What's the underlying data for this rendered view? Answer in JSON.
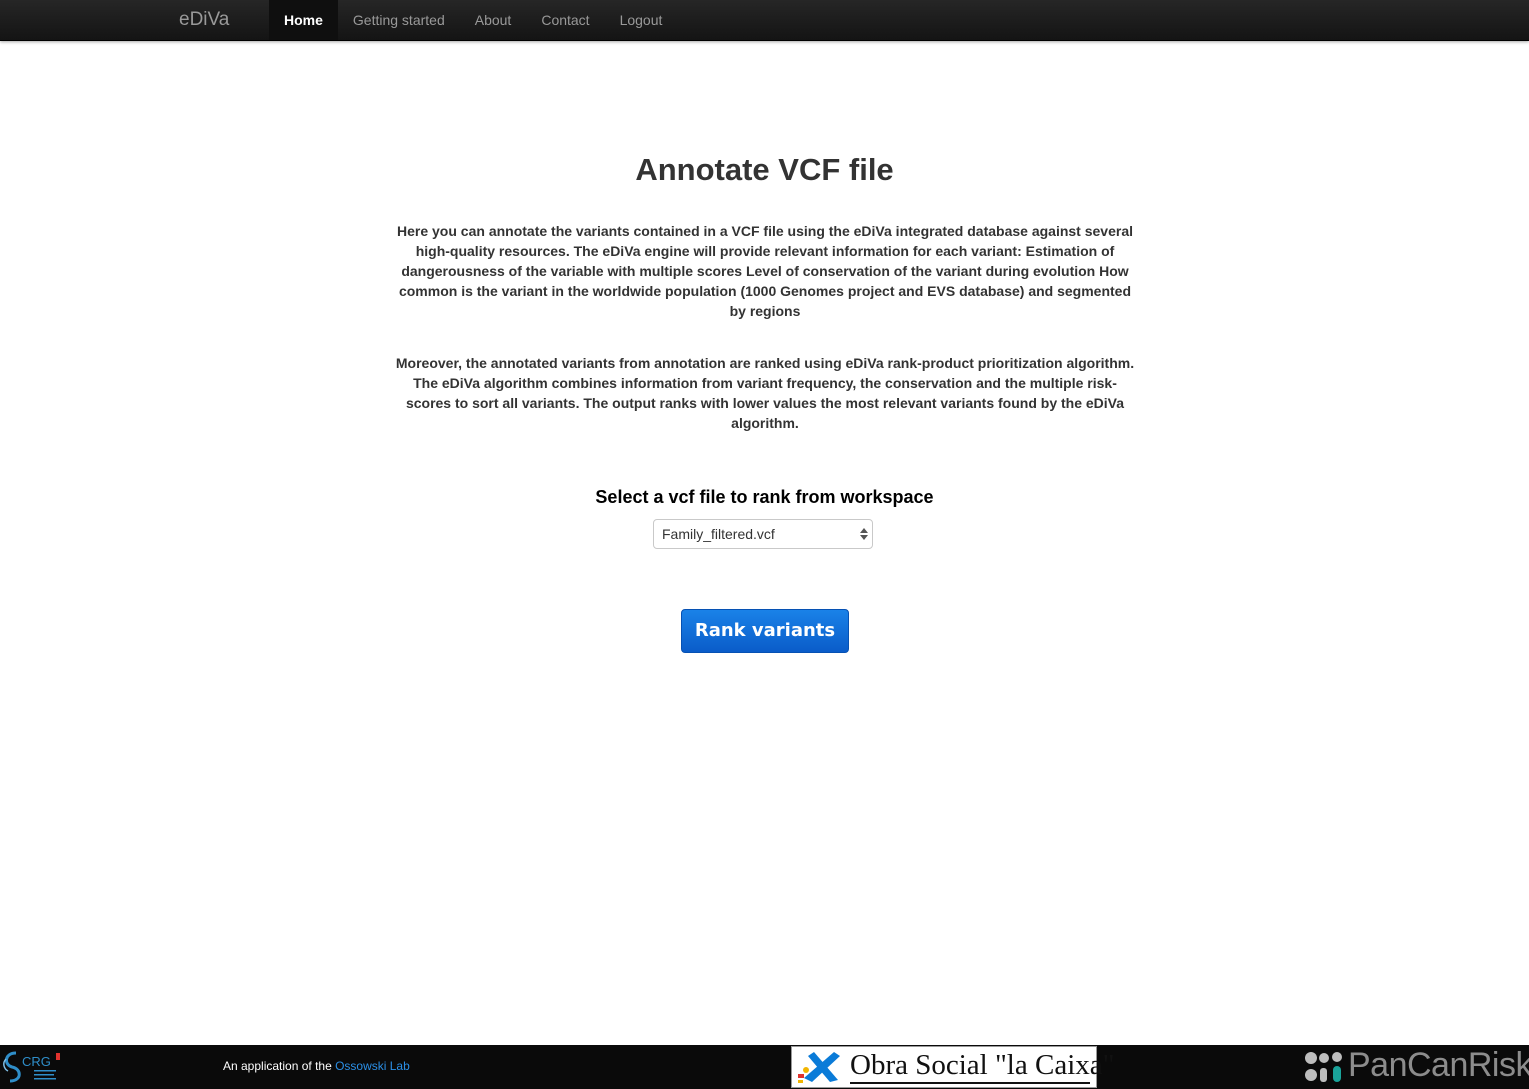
{
  "navbar": {
    "brand": "eDiVa",
    "items": [
      {
        "label": "Home",
        "active": true
      },
      {
        "label": "Getting started",
        "active": false
      },
      {
        "label": "About",
        "active": false
      },
      {
        "label": "Contact",
        "active": false
      },
      {
        "label": "Logout",
        "active": false
      }
    ]
  },
  "main": {
    "title": "Annotate VCF file",
    "paragraph_1": "Here you can annotate the variants contained in a VCF file using the eDiVa integrated database against several high-quality resources. The eDiVa engine will provide relevant information for each variant: Estimation of dangerousness of the variable with multiple scores Level of conservation of the variant during evolution How common is the variant in the worldwide population (1000 Genomes project and EVS database) and segmented by regions",
    "paragraph_2": "Moreover, the annotated variants from annotation are ranked using eDiVa rank-product prioritization algorithm. The eDiVa algorithm combines information from variant frequency, the conservation and the multiple risk-scores to sort all variants. The output ranks with lower values the most relevant variants found by the eDiVa algorithm.",
    "select_label": "Select a vcf file to rank from workspace",
    "select_value": "Family_filtered.vcf",
    "rank_button": "Rank variants"
  },
  "footer": {
    "crg_logo_text": "CRG",
    "app_text": "An application of the ",
    "lab_link": "Ossowski Lab",
    "caixa_logo_text": "Obra Social \"la Caixa\"",
    "pancan_logo_text": "PanCanRisk"
  },
  "colors": {
    "navbar_bg": "#1b1b1b",
    "button_blue": "#0a6fd8",
    "link_blue": "#2b8fe6",
    "footer_bg": "#0a0a0a"
  }
}
